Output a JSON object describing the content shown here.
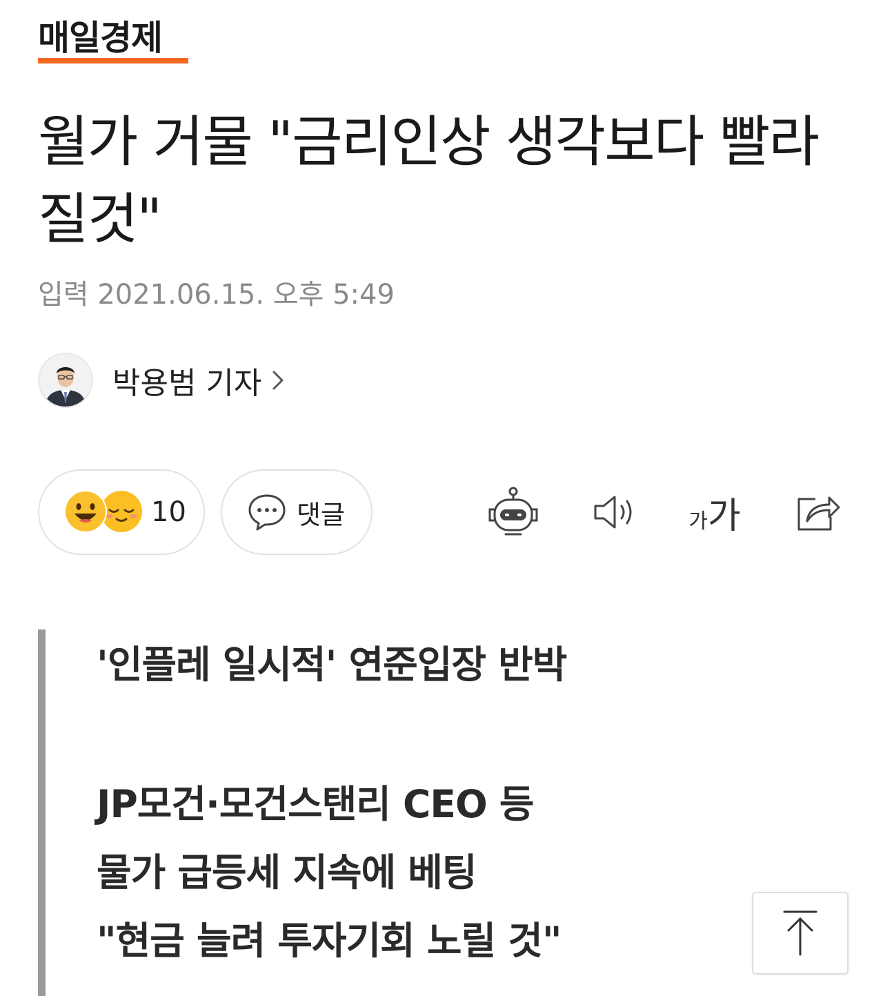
{
  "brand": {
    "logo_text": "매일경제",
    "accent_color": "#f26a21"
  },
  "article": {
    "headline": "월가 거물 \"금리인상 생각보다 빨라질것\"",
    "published": "입력 2021.06.15. 오후 5:49",
    "reporter": {
      "name": "박용범 기자",
      "avatar_icon": "reporter-avatar",
      "chevron_icon": "chevron-right-icon"
    }
  },
  "toolbar": {
    "reactions": {
      "count": "10",
      "emoji_icons": [
        "smile-emoji-icon",
        "content-emoji-icon"
      ]
    },
    "comments": {
      "label": "댓글",
      "icon": "speech-bubble-icon"
    },
    "font_size": {
      "small_glyph": "가",
      "large_glyph": "가"
    },
    "icons": [
      "robot-icon",
      "speaker-icon",
      "font-size-icon",
      "share-icon"
    ]
  },
  "summary": {
    "lines": [
      "'인플레 일시적' 연준입장 반박",
      "JP모건·모건스탠리 CEO 등",
      "물가 급등세 지속에 베팅",
      "\"현금 늘려 투자기회 노릴 것\""
    ]
  },
  "scroll_top": {
    "icon": "arrow-up-to-top-icon"
  }
}
